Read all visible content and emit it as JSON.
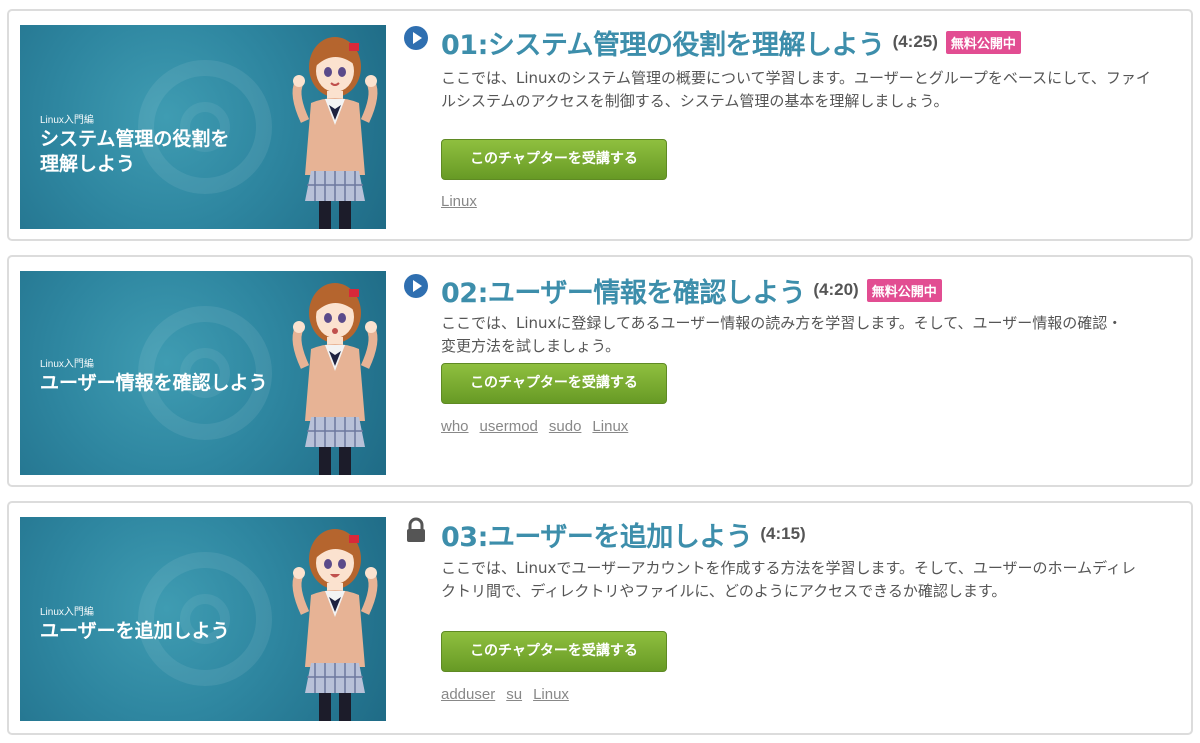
{
  "colors": {
    "title": "#3d8eab",
    "badge": "#e24d92",
    "button": "#7aa932",
    "thumbnail_bg": "#2e86a0"
  },
  "chapters": [
    {
      "status_icon": "play-icon",
      "thumb_series": "Linux入門編",
      "thumb_title": "システム管理の役割を理解しよう",
      "title": "01:システム管理の役割を理解しよう",
      "duration": "(4:25)",
      "badge": "無料公開中",
      "description": "ここでは、Linuxのシステム管理の概要について学習します。ユーザーとグループをベースにして、ファイルシステムのアクセスを制御する、システム管理の基本を理解しましょう。",
      "button_label": "このチャプターを受講する",
      "tags": [
        "Linux"
      ]
    },
    {
      "status_icon": "play-icon",
      "thumb_series": "Linux入門編",
      "thumb_title": "ユーザー情報を確認しよう",
      "title": "02:ユーザー情報を確認しよう",
      "duration": "(4:20)",
      "badge": "無料公開中",
      "description": "ここでは、Linuxに登録してあるユーザー情報の読み方を学習します。そして、ユーザー情報の確認・変更方法を試しましょう。",
      "button_label": "このチャプターを受講する",
      "tags": [
        "who",
        "usermod",
        "sudo",
        "Linux"
      ]
    },
    {
      "status_icon": "lock-icon",
      "thumb_series": "Linux入門編",
      "thumb_title": "ユーザーを追加しよう",
      "title": "03:ユーザーを追加しよう",
      "duration": "(4:15)",
      "badge": "",
      "description": "ここでは、Linuxでユーザーアカウントを作成する方法を学習します。そして、ユーザーのホームディレクトリ間で、ディレクトリやファイルに、どのようにアクセスできるか確認します。",
      "button_label": "このチャプターを受講する",
      "tags": [
        "adduser",
        "su",
        "Linux"
      ]
    }
  ]
}
